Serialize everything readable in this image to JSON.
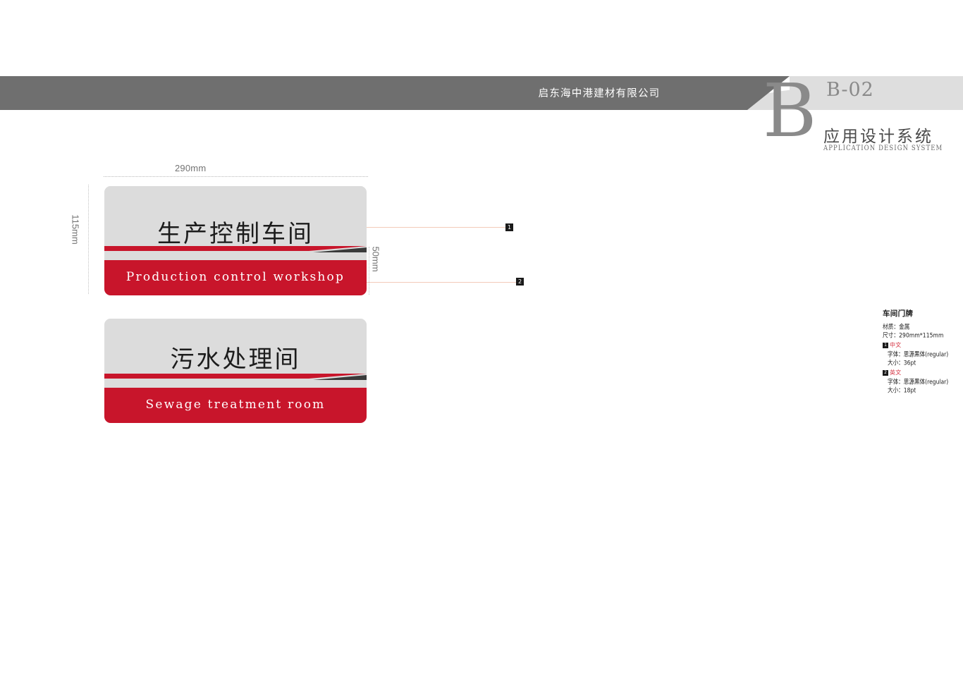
{
  "header": {
    "company_name": "启东海中港建材有限公司",
    "big_letter": "B",
    "code": "B-02",
    "section_cn": "应用设计系统",
    "section_en": "APPLICATION DESIGN SYSTEM",
    "band_dark_color": "#6f6f6f",
    "band_light_color": "#dedede"
  },
  "dimensions": {
    "width_label": "290mm",
    "height_label": "115mm",
    "bottom_band_label": "50mm"
  },
  "callouts": [
    {
      "number": "1",
      "target": "chinese-text"
    },
    {
      "number": "2",
      "target": "english-text"
    }
  ],
  "plates": [
    {
      "cn": "生产控制车间",
      "en": "Production control workshop",
      "top_color": "#dcdcdc",
      "bottom_color": "#c8152b",
      "accent_color": "#3a3a3a"
    },
    {
      "cn": "污水处理间",
      "en": "Sewage treatment room",
      "top_color": "#dcdcdc",
      "bottom_color": "#c8152b",
      "accent_color": "#3a3a3a"
    }
  ],
  "spec": {
    "title": "车间门牌",
    "material_line": "材质：金属",
    "size_line": "尺寸：290mm*115mm",
    "groups": [
      {
        "num": "1",
        "lang": "中文",
        "font_line": "字体：思源黑体(regular)",
        "size_line": "大小：36pt"
      },
      {
        "num": "2",
        "lang": "英文",
        "font_line": "字体：思源黑体(regular)",
        "size_line": "大小：18pt"
      }
    ],
    "accent_color": "#d4303f"
  }
}
